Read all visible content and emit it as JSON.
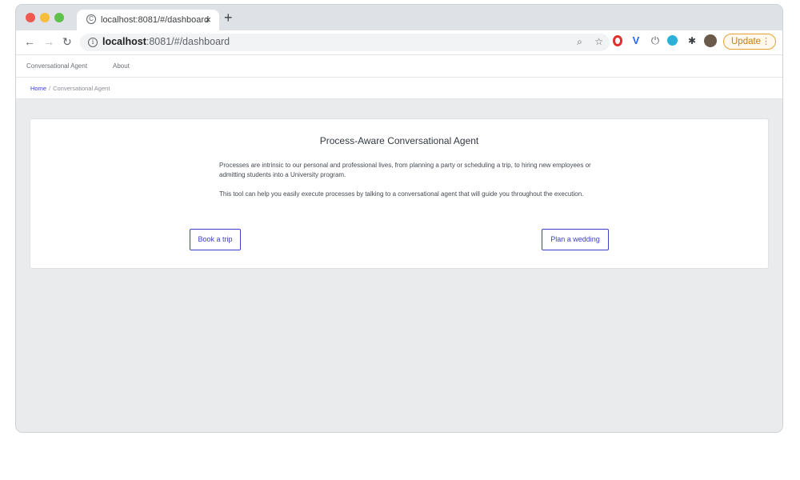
{
  "browser": {
    "tab_title": "localhost:8081/#/dashboard",
    "tab_close": "×",
    "new_tab": "+",
    "url_host": "localhost",
    "url_rest": ":8081/#/dashboard",
    "update_label": "Update",
    "colors": {
      "tabbar": "#dee1e6",
      "update": "#e5a136"
    }
  },
  "appnav": {
    "items": [
      "Conversational Agent",
      "About"
    ]
  },
  "breadcrumb": {
    "home": "Home",
    "separator": "/",
    "current": "Conversational Agent"
  },
  "card": {
    "title": "Process-Aware Conversational Agent",
    "paragraph1": "Processes are intrinsic to our personal and professional lives, from planning a party or scheduling a trip, to hiring new employees or admitting students into a University program.",
    "paragraph2": "This tool can help you easily execute processes by talking to a conversational agent that will guide you throughout the execution.",
    "buttons": [
      "Book a trip",
      "Plan a wedding"
    ]
  },
  "colors": {
    "accent": "#3c3fc7",
    "page_bg": "#eaebed"
  }
}
